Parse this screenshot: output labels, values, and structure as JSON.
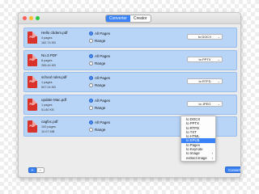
{
  "toolbar": {
    "tabs": [
      "Converter",
      "Creator"
    ]
  },
  "files": [
    {
      "name": "Hello cbdem.pdf",
      "pages": "4 pages",
      "size": "162.74 KB",
      "all_label": "All Pages",
      "range_label": "Range",
      "target": "to DOCX"
    },
    {
      "name": "No.3.PDF",
      "pages": "8 pages",
      "size": "265.44 KB",
      "all_label": "All Pages",
      "range_label": "Range",
      "target": "to PPTX"
    },
    {
      "name": "school rules.pdf",
      "pages": "1 pages",
      "size": "507.24 KB",
      "all_label": "All Pages",
      "range_label": "Range",
      "target": "to RTFD"
    },
    {
      "name": "update Mac.pdf",
      "pages": "1 pages",
      "size": "51.80 KB",
      "all_label": "All Pages",
      "range_label": "Range",
      "target": "to JPEG"
    },
    {
      "name": "cagfvc.pdf",
      "pages": "100 pages",
      "size": "10.07 MB",
      "all_label": "All Pages",
      "range_label": "Range",
      "target": ""
    }
  ],
  "dropdown": {
    "items": [
      "to DOCX",
      "to PPTX",
      "to RTFD",
      "to TXT",
      "to HTML",
      "to EPUB",
      "to Pages",
      "to Keynote",
      "to Image",
      "extract image"
    ],
    "selected": "to EPUB"
  },
  "footer": {
    "add": "+",
    "remove": "−",
    "convert_label": "Convert"
  }
}
